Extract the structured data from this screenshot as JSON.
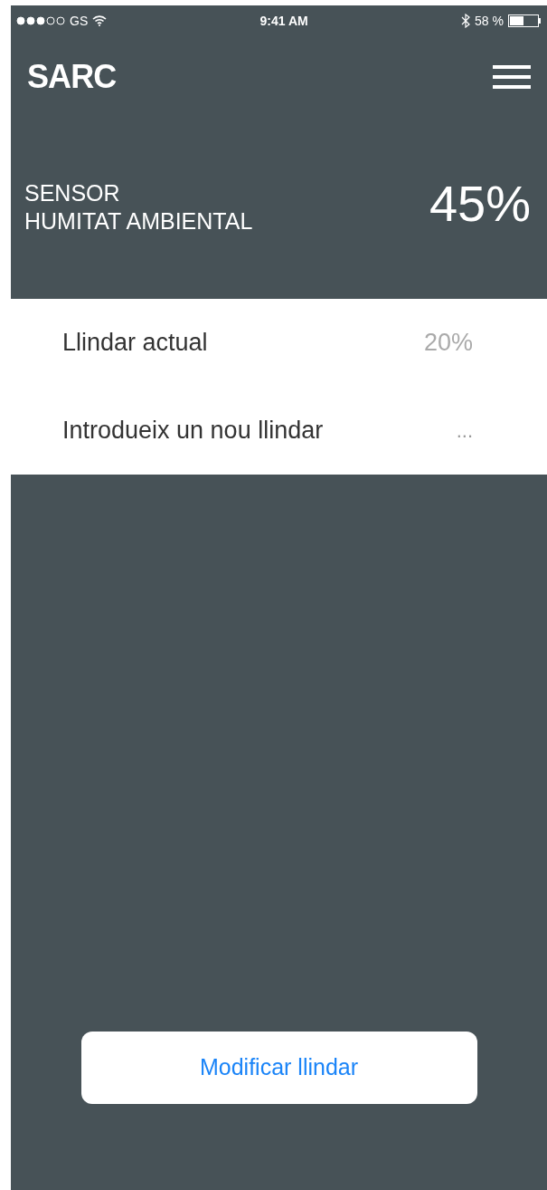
{
  "status_bar": {
    "carrier": "GS",
    "time": "9:41 AM",
    "battery": "58 %"
  },
  "header": {
    "title": "SARC"
  },
  "sensor": {
    "label_lines": [
      "SENSOR",
      "HUMITAT AMBIENTAL"
    ],
    "value": "45%"
  },
  "rows": [
    {
      "kind": "value",
      "label": "Llindar actual",
      "value": "20%"
    },
    {
      "kind": "input",
      "label": "Introdueix un nou llindar",
      "placeholder": "..."
    }
  ],
  "button": {
    "label": "Modificar llindar"
  }
}
